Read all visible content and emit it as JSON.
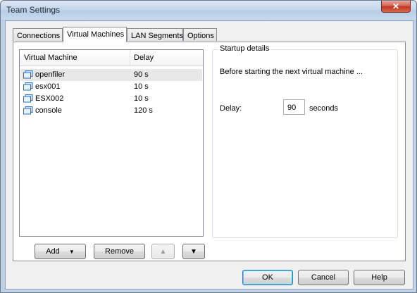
{
  "window": {
    "title": "Team Settings"
  },
  "tabs": [
    {
      "label": "Connections"
    },
    {
      "label": "Virtual Machines"
    },
    {
      "label": "LAN Segments"
    },
    {
      "label": "Options"
    }
  ],
  "vm_list": {
    "columns": {
      "name": "Virtual Machine",
      "delay": "Delay"
    },
    "rows": [
      {
        "name": "openfiler",
        "delay": "90 s"
      },
      {
        "name": "esx001",
        "delay": "10 s"
      },
      {
        "name": "ESX002",
        "delay": "10 s"
      },
      {
        "name": "console",
        "delay": "120 s"
      }
    ]
  },
  "list_buttons": {
    "add": "Add",
    "remove": "Remove"
  },
  "startup": {
    "title": "Startup details",
    "description": "Before starting the next virtual machine ...",
    "delay_label": "Delay:",
    "delay_value": "90",
    "unit": "seconds"
  },
  "footer": {
    "ok": "OK",
    "cancel": "Cancel",
    "help": "Help"
  },
  "colors": {
    "title_bar": "#c3d5ea",
    "close_button": "#c2331f",
    "vm_icon": "#2a6fc4"
  }
}
